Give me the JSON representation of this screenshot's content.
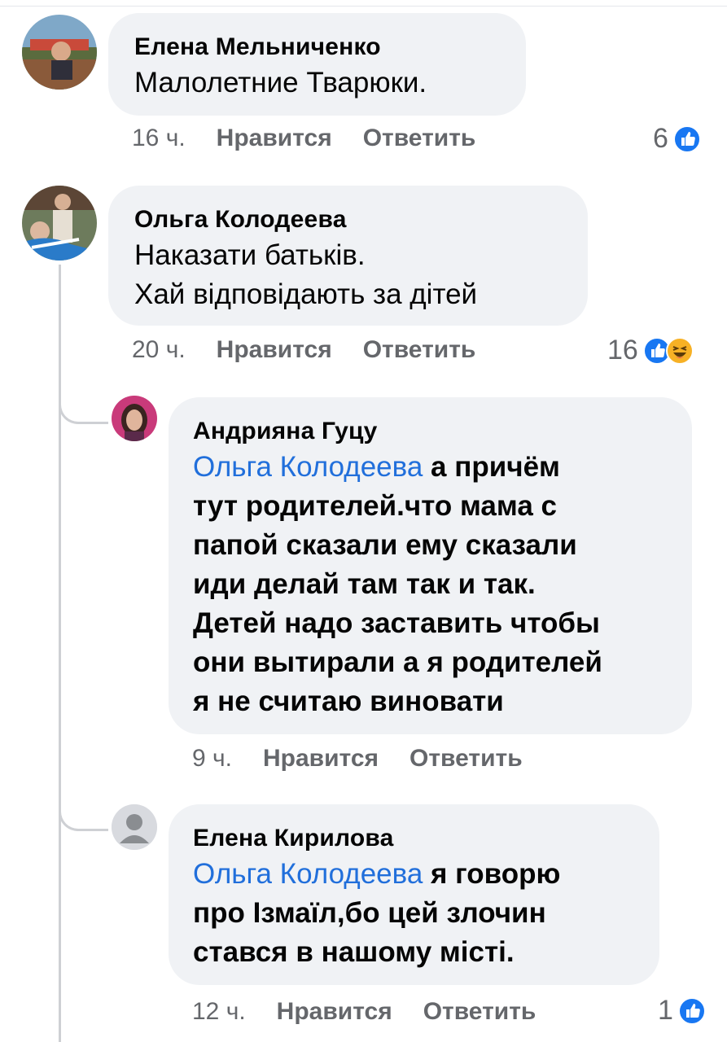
{
  "comments": [
    {
      "author": "Елена Мельниченко",
      "text": "Малолетние Тварюки.",
      "time": "16 ч.",
      "like_label": "Нравится",
      "reply_label": "Ответить",
      "reaction_count": "6",
      "reactions": [
        "like-icon"
      ]
    },
    {
      "author": "Ольга Колодеева",
      "lines": [
        "Наказати батьків.",
        "Хай відповідають за дітей"
      ],
      "time": "20 ч.",
      "like_label": "Нравится",
      "reply_label": "Ответить",
      "reaction_count": "16",
      "reactions": [
        "like-icon",
        "haha-icon"
      ]
    }
  ],
  "replies": [
    {
      "author": "Андрияна Гуцу",
      "mention": "Ольга Колодеева",
      "lines": [
        " а причём",
        "тут родителей.что мама с",
        "папой сказали ему сказали",
        "иди делай там так и так.",
        "Детей надо заставить чтобы",
        "они вытирали а я родителей",
        "я не считаю виновати"
      ],
      "time": "9 ч.",
      "like_label": "Нравится",
      "reply_label": "Ответить"
    },
    {
      "author": "Елена Кирилова",
      "mention": "Ольга Колодеева",
      "lines": [
        " я говорю",
        "про Ізмаїл,бо цей злочин",
        "стався в нашому місті."
      ],
      "time": "12 ч.",
      "like_label": "Нравится",
      "reply_label": "Ответить",
      "reaction_count": "1",
      "reactions": [
        "like-icon"
      ]
    }
  ],
  "colors": {
    "bubble": "#f0f2f5",
    "mention": "#216fdb",
    "meta": "#65676b",
    "like_blue": "#1877f2"
  }
}
